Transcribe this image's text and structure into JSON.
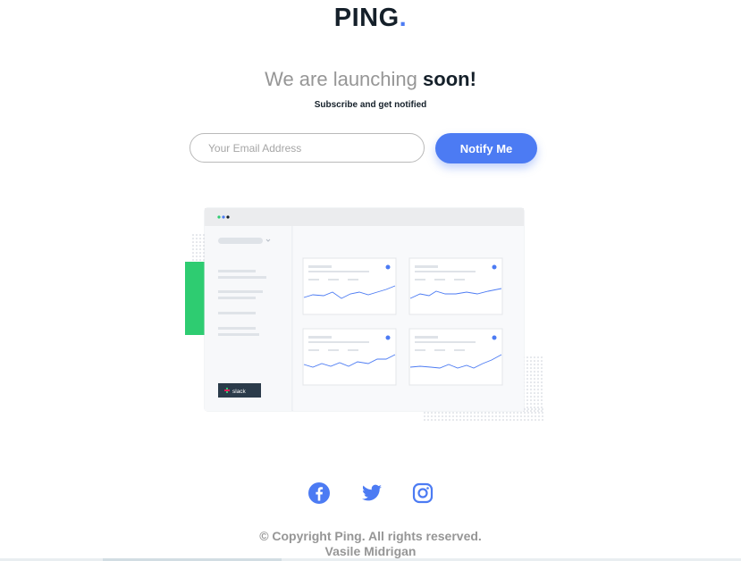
{
  "brand": {
    "name": "PING",
    "dot": ".",
    "accent": "#4c7bf3",
    "dark": "#15202a",
    "gray": "#969696"
  },
  "hero": {
    "headline_light": "We are launching",
    "headline_bold": "soon!",
    "subline": "Subscribe and get notified"
  },
  "form": {
    "email_placeholder": "Your Email Address",
    "email_value": "",
    "submit_label": "Notify Me"
  },
  "illustration": {
    "sidebar_badge": "slack"
  },
  "socials": [
    {
      "name": "facebook",
      "icon": "facebook-icon"
    },
    {
      "name": "twitter",
      "icon": "twitter-icon"
    },
    {
      "name": "instagram",
      "icon": "instagram-icon"
    }
  ],
  "footer": {
    "copyright": "© Copyright Ping. All rights reserved.",
    "author": "Vasile Midrigan"
  }
}
